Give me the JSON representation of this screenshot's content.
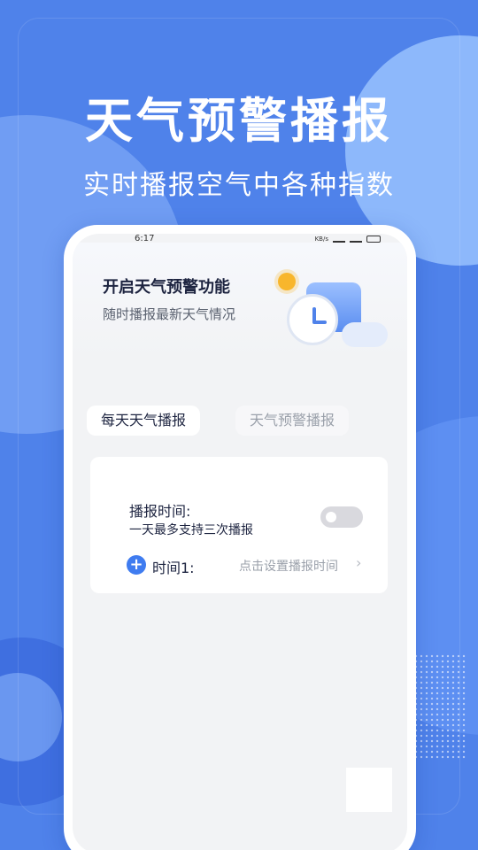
{
  "hero": {
    "title": "天气预警播报",
    "subtitle": "实时播报空气中各种指数"
  },
  "status_bar": {
    "time": "6:17",
    "net_speed": "KB/s"
  },
  "banner": {
    "title": "开启天气预警功能",
    "subtitle": "随时播报最新天气情况"
  },
  "tabs": [
    {
      "label": "每天天气播报",
      "active": true
    },
    {
      "label": "天气预警播报",
      "active": false
    }
  ],
  "broadcast_card": {
    "label": "播报时间:",
    "description": "一天最多支持三次播报",
    "toggle_on": false,
    "time_slot": {
      "label": "时间1:",
      "hint": "点击设置播报时间",
      "chevron": "›",
      "add_glyph": "+"
    }
  },
  "colors": {
    "background": "#4f82ea",
    "accent": "#3f7cf0",
    "text_primary": "#1d2440",
    "text_muted": "#9aa0aa"
  },
  "icons": [
    "sun-icon",
    "calendar-icon",
    "clock-icon",
    "cloud-icon",
    "add-icon",
    "chevron-right-icon"
  ]
}
